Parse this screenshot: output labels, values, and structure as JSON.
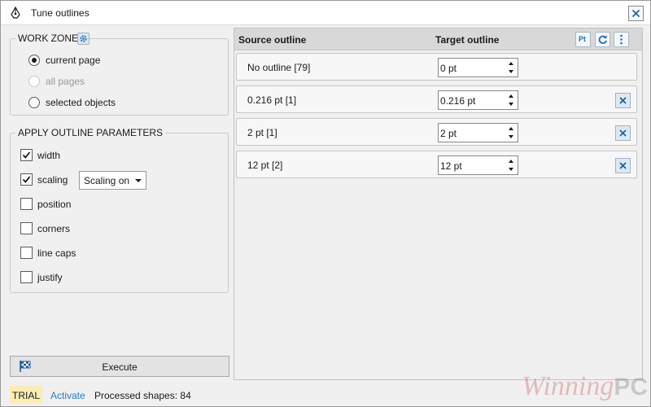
{
  "window": {
    "title": "Tune outlines"
  },
  "colors": {
    "accent": "#2a7ab8",
    "trial_bg": "#fbecb5",
    "header_bg": "#d8d8d8",
    "panel_bg": "#f0f0f0"
  },
  "icons": {
    "app": "pen-nib-icon",
    "close": "close-icon",
    "work_zone_settings": "gear-icon",
    "execute": "checkered-flag-icon",
    "header_units": "pt-units-icon",
    "header_refresh": "refresh-icon",
    "header_more": "more-vertical-icon",
    "row_remove": "remove-x-icon"
  },
  "work_zone": {
    "title": "WORK ZONE",
    "options": [
      {
        "label": "current page",
        "checked": true,
        "enabled": true
      },
      {
        "label": "all pages",
        "checked": false,
        "enabled": false
      },
      {
        "label": "selected objects",
        "checked": false,
        "enabled": true
      }
    ]
  },
  "apply_params": {
    "title": "APPLY OUTLINE PARAMETERS",
    "options": [
      {
        "label": "width",
        "checked": true
      },
      {
        "label": "scaling",
        "checked": true
      },
      {
        "label": "position",
        "checked": false
      },
      {
        "label": "corners",
        "checked": false
      },
      {
        "label": "line caps",
        "checked": false
      },
      {
        "label": "justify",
        "checked": false
      }
    ],
    "scaling_select": {
      "value": "Scaling on"
    }
  },
  "execute_label": "Execute",
  "table": {
    "headers": {
      "source": "Source outline",
      "target": "Target outline",
      "units_button": "Pt"
    },
    "rows": [
      {
        "source": "No outline  [79]",
        "target": "0 pt",
        "removable": false
      },
      {
        "source": "0.216 pt  [1]",
        "target": "0.216 pt",
        "removable": true
      },
      {
        "source": "2 pt  [1]",
        "target": "2 pt",
        "removable": true
      },
      {
        "source": "12 pt  [2]",
        "target": "12 pt",
        "removable": true
      }
    ]
  },
  "status": {
    "trial": "TRIAL",
    "activate": "Activate",
    "processed": "Processed shapes: 84"
  },
  "watermark": {
    "main": "Winning",
    "suffix": "PC"
  }
}
